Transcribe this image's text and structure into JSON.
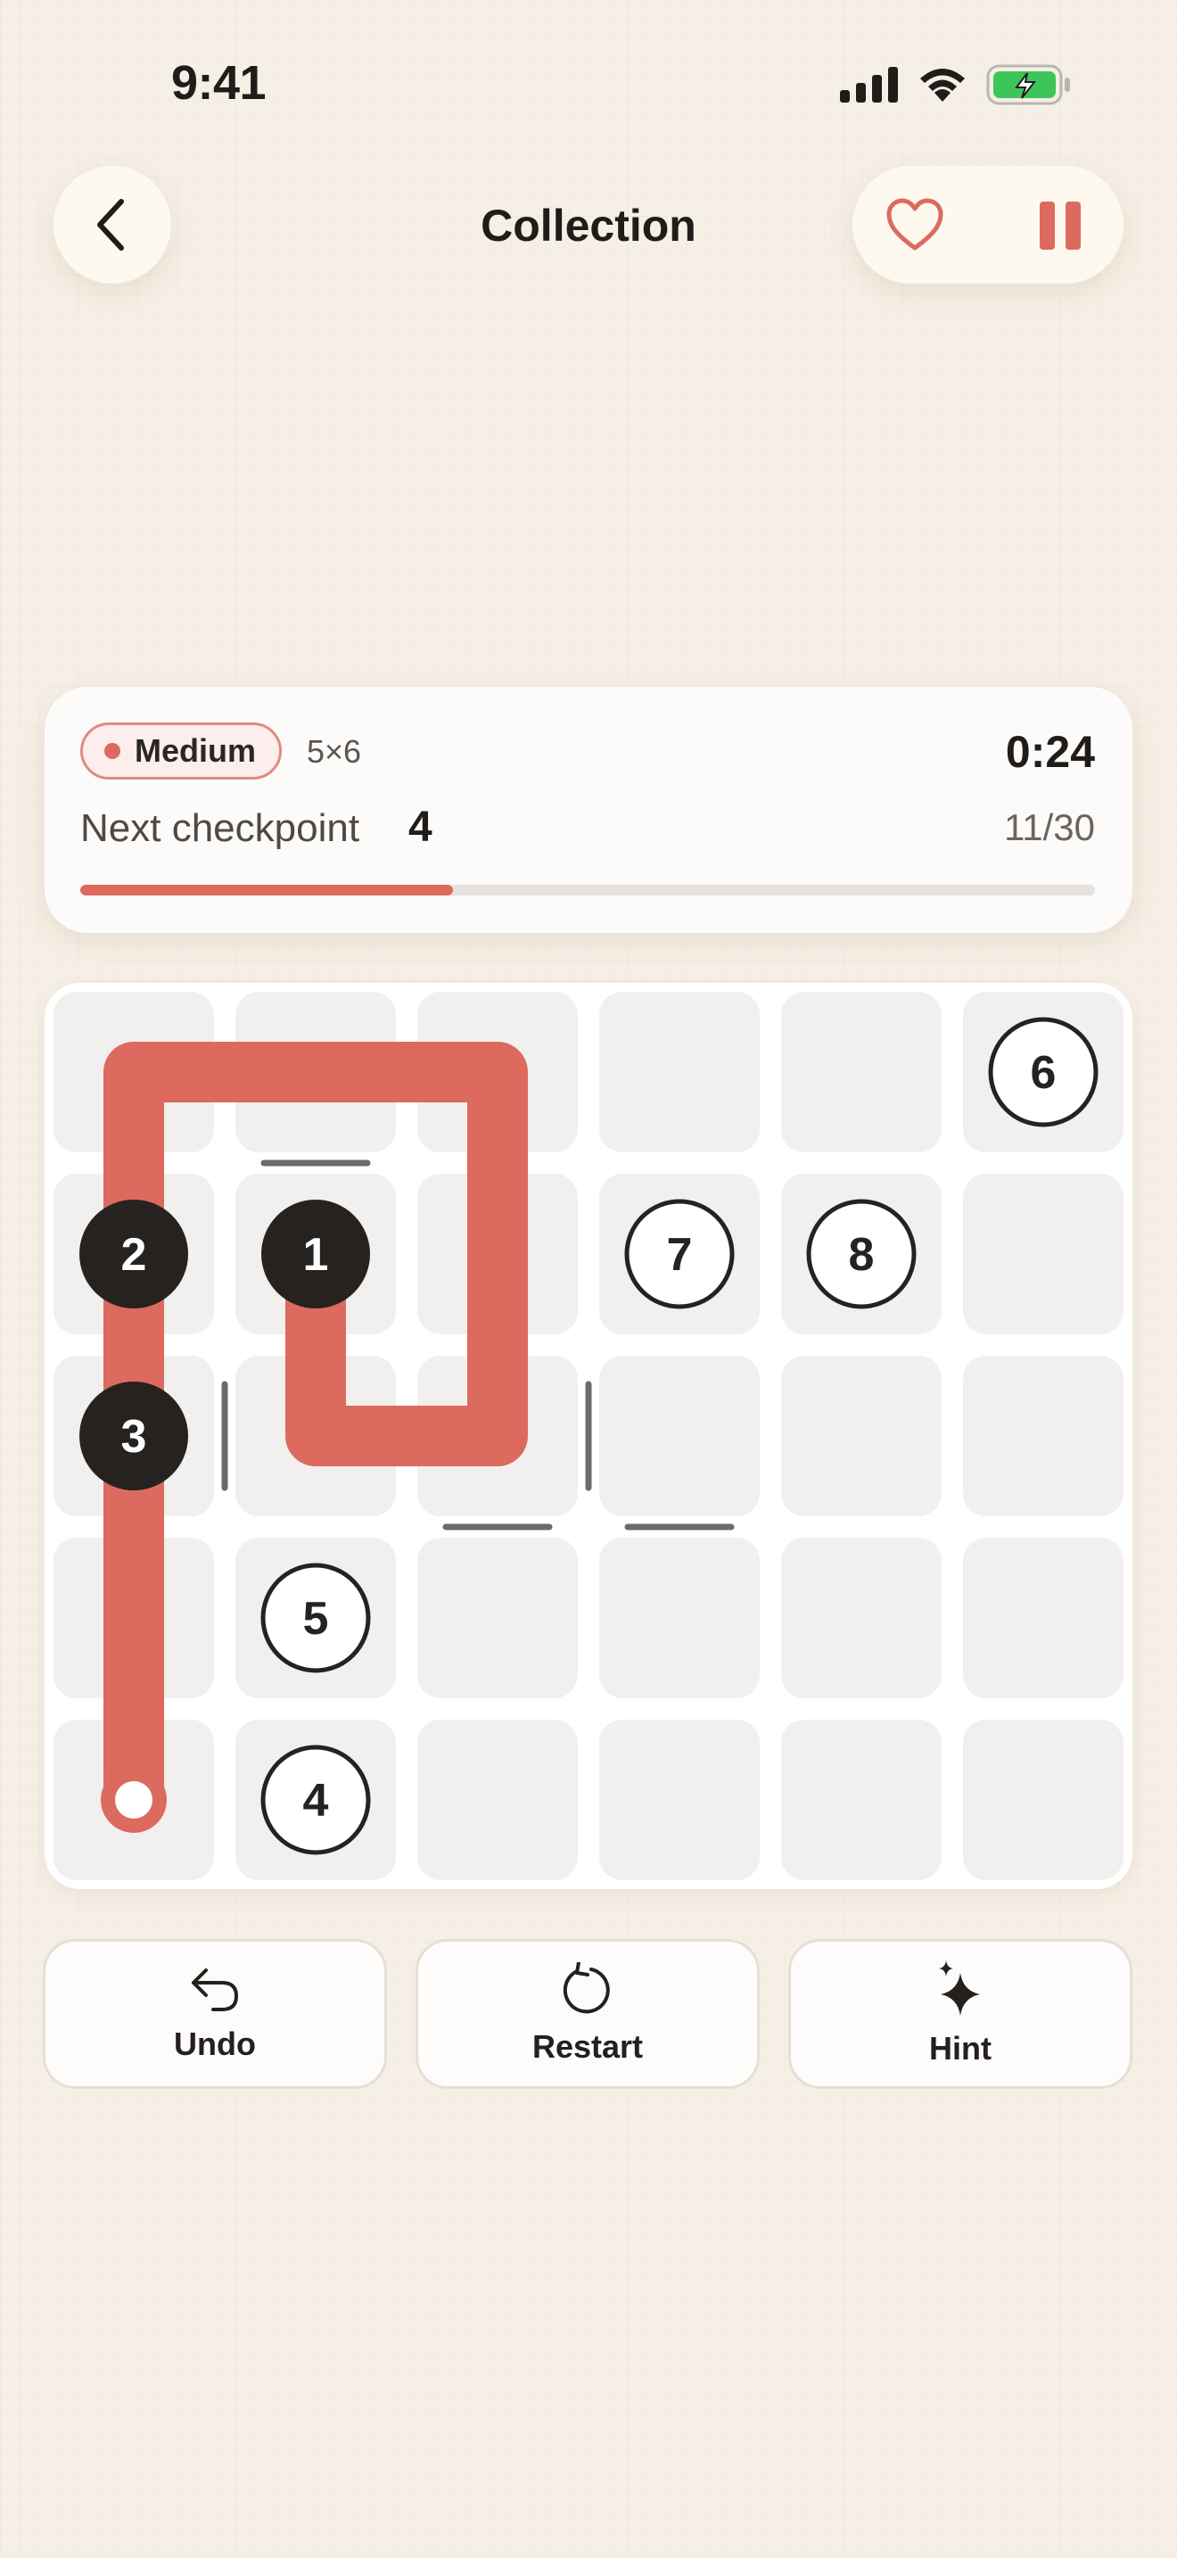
{
  "status_bar": {
    "time": "9:41"
  },
  "header": {
    "title": "Collection"
  },
  "info": {
    "difficulty": "Medium",
    "grid_size": "5×6",
    "timer": "0:24",
    "next_checkpoint_label": "Next checkpoint",
    "next_checkpoint_value": "4",
    "progress_text": "11/30",
    "progress_fraction": 0.367
  },
  "board": {
    "rows": 5,
    "cols": 6,
    "checkpoints": [
      {
        "label": "6",
        "row": 0,
        "col": 5,
        "visited": false
      },
      {
        "label": "2",
        "row": 1,
        "col": 0,
        "visited": true
      },
      {
        "label": "1",
        "row": 1,
        "col": 1,
        "visited": true
      },
      {
        "label": "7",
        "row": 1,
        "col": 3,
        "visited": false
      },
      {
        "label": "8",
        "row": 1,
        "col": 4,
        "visited": false
      },
      {
        "label": "3",
        "row": 2,
        "col": 0,
        "visited": true
      },
      {
        "label": "5",
        "row": 3,
        "col": 1,
        "visited": false
      },
      {
        "label": "4",
        "row": 4,
        "col": 1,
        "visited": false
      }
    ],
    "path": [
      [
        1,
        1
      ],
      [
        2,
        1
      ],
      [
        2,
        2
      ],
      [
        1,
        2
      ],
      [
        0,
        2
      ],
      [
        0,
        1
      ],
      [
        0,
        0
      ],
      [
        1,
        0
      ],
      [
        2,
        0
      ],
      [
        3,
        0
      ],
      [
        4,
        0
      ]
    ],
    "walls": [
      {
        "between": [
          [
            0,
            1
          ],
          [
            1,
            1
          ]
        ]
      },
      {
        "between": [
          [
            2,
            0
          ],
          [
            2,
            1
          ]
        ]
      },
      {
        "between": [
          [
            2,
            2
          ],
          [
            2,
            3
          ]
        ]
      },
      {
        "between": [
          [
            2,
            2
          ],
          [
            3,
            2
          ]
        ]
      },
      {
        "between": [
          [
            2,
            3
          ],
          [
            3,
            3
          ]
        ]
      }
    ],
    "colors": {
      "path": "#dd6a5e",
      "cell": "#f1f0ef",
      "visited_node": "#252220",
      "wall": "#6b6b6b"
    }
  },
  "actions": {
    "undo": "Undo",
    "restart": "Restart",
    "hint": "Hint"
  }
}
